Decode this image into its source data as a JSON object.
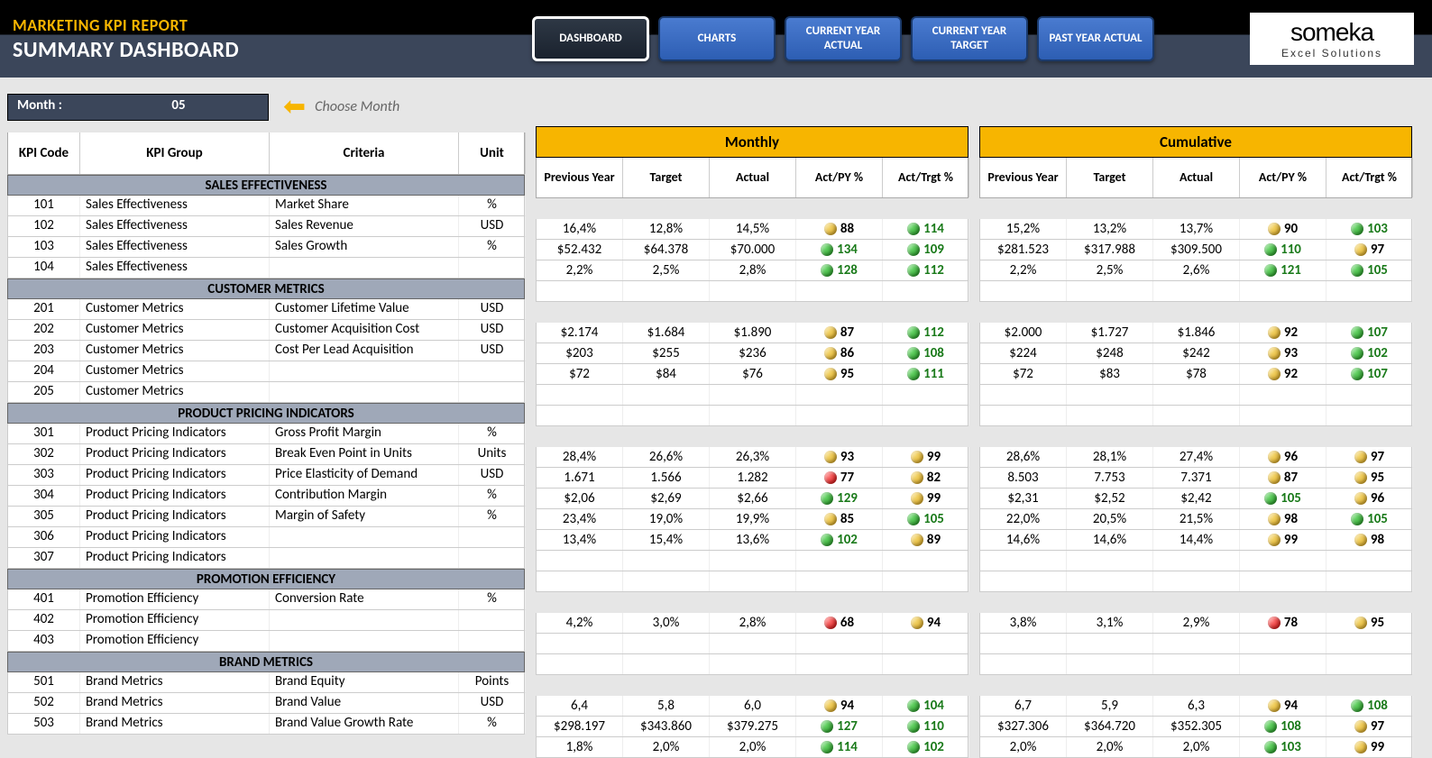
{
  "header": {
    "title": "MARKETING KPI REPORT",
    "subtitle": "SUMMARY DASHBOARD",
    "logo_name": "someka",
    "logo_sub": "Excel Solutions"
  },
  "nav": {
    "dashboard": "DASHBOARD",
    "charts": "CHARTS",
    "cy_actual": "CURRENT YEAR ACTUAL",
    "cy_target": "CURRENT YEAR TARGET",
    "py_actual": "PAST YEAR ACTUAL"
  },
  "month": {
    "label": "Month :",
    "value": "05",
    "choose": "Choose Month"
  },
  "left_headers": {
    "code": "KPI Code",
    "group": "KPI Group",
    "criteria": "Criteria",
    "unit": "Unit"
  },
  "data_section_monthly": "Monthly",
  "data_section_cumulative": "Cumulative",
  "data_headers": {
    "py": "Previous Year",
    "target": "Target",
    "actual": "Actual",
    "act_py": "Act/PY %",
    "act_trgt": "Act/Trgt %"
  },
  "groups": [
    {
      "title": "SALES EFFECTIVENESS",
      "rows": [
        {
          "code": "101",
          "group": "Sales Effectiveness",
          "criteria": "Market Share",
          "unit": "%",
          "m": {
            "py": "16,4%",
            "t": "12,8%",
            "a": "14,5%",
            "ap": "88",
            "apc": "y",
            "at": "114",
            "atc": "g"
          },
          "c": {
            "py": "15,2%",
            "t": "13,2%",
            "a": "13,7%",
            "ap": "90",
            "apc": "y",
            "at": "103",
            "atc": "g"
          }
        },
        {
          "code": "102",
          "group": "Sales Effectiveness",
          "criteria": "Sales Revenue",
          "unit": "USD",
          "m": {
            "py": "$52.432",
            "t": "$64.378",
            "a": "$70.000",
            "ap": "134",
            "apc": "g",
            "at": "109",
            "atc": "g"
          },
          "c": {
            "py": "$281.523",
            "t": "$317.988",
            "a": "$309.500",
            "ap": "110",
            "apc": "g",
            "at": "97",
            "atc": "y"
          }
        },
        {
          "code": "103",
          "group": "Sales Effectiveness",
          "criteria": "Sales Growth",
          "unit": "%",
          "m": {
            "py": "2,2%",
            "t": "2,5%",
            "a": "2,8%",
            "ap": "128",
            "apc": "g",
            "at": "112",
            "atc": "g"
          },
          "c": {
            "py": "2,2%",
            "t": "2,5%",
            "a": "2,6%",
            "ap": "121",
            "apc": "g",
            "at": "105",
            "atc": "g"
          }
        },
        {
          "code": "104",
          "group": "Sales Effectiveness",
          "criteria": "",
          "unit": "",
          "m": null,
          "c": null
        }
      ]
    },
    {
      "title": "CUSTOMER METRICS",
      "rows": [
        {
          "code": "201",
          "group": "Customer Metrics",
          "criteria": "Customer Lifetime Value",
          "unit": "USD",
          "m": {
            "py": "$2.174",
            "t": "$1.684",
            "a": "$1.890",
            "ap": "87",
            "apc": "y",
            "at": "112",
            "atc": "g"
          },
          "c": {
            "py": "$2.000",
            "t": "$1.727",
            "a": "$1.846",
            "ap": "92",
            "apc": "y",
            "at": "107",
            "atc": "g"
          }
        },
        {
          "code": "202",
          "group": "Customer Metrics",
          "criteria": "Customer Acquisition Cost",
          "unit": "USD",
          "m": {
            "py": "$203",
            "t": "$255",
            "a": "$236",
            "ap": "86",
            "apc": "y",
            "at": "108",
            "atc": "g"
          },
          "c": {
            "py": "$224",
            "t": "$248",
            "a": "$242",
            "ap": "93",
            "apc": "y",
            "at": "102",
            "atc": "g"
          }
        },
        {
          "code": "203",
          "group": "Customer Metrics",
          "criteria": "Cost Per Lead Acquisition",
          "unit": "USD",
          "m": {
            "py": "$72",
            "t": "$84",
            "a": "$76",
            "ap": "95",
            "apc": "y",
            "at": "111",
            "atc": "g"
          },
          "c": {
            "py": "$72",
            "t": "$83",
            "a": "$78",
            "ap": "92",
            "apc": "y",
            "at": "107",
            "atc": "g"
          }
        },
        {
          "code": "204",
          "group": "Customer Metrics",
          "criteria": "",
          "unit": "",
          "m": null,
          "c": null
        },
        {
          "code": "205",
          "group": "Customer Metrics",
          "criteria": "",
          "unit": "",
          "m": null,
          "c": null
        }
      ]
    },
    {
      "title": "PRODUCT PRICING INDICATORS",
      "rows": [
        {
          "code": "301",
          "group": "Product Pricing Indicators",
          "criteria": "Gross Profit Margin",
          "unit": "%",
          "m": {
            "py": "28,4%",
            "t": "26,6%",
            "a": "26,3%",
            "ap": "93",
            "apc": "y",
            "at": "99",
            "atc": "y"
          },
          "c": {
            "py": "28,6%",
            "t": "28,1%",
            "a": "27,4%",
            "ap": "96",
            "apc": "y",
            "at": "97",
            "atc": "y"
          }
        },
        {
          "code": "302",
          "group": "Product Pricing Indicators",
          "criteria": "Break Even Point in Units",
          "unit": "Units",
          "m": {
            "py": "1.671",
            "t": "1.566",
            "a": "1.282",
            "ap": "77",
            "apc": "r",
            "at": "82",
            "atc": "y"
          },
          "c": {
            "py": "8.503",
            "t": "7.753",
            "a": "7.371",
            "ap": "87",
            "apc": "y",
            "at": "95",
            "atc": "y"
          }
        },
        {
          "code": "303",
          "group": "Product Pricing Indicators",
          "criteria": "Price Elasticity of Demand",
          "unit": "USD",
          "m": {
            "py": "$2,06",
            "t": "$2,69",
            "a": "$2,66",
            "ap": "129",
            "apc": "g",
            "at": "99",
            "atc": "y"
          },
          "c": {
            "py": "$2,31",
            "t": "$2,52",
            "a": "$2,42",
            "ap": "105",
            "apc": "g",
            "at": "96",
            "atc": "y"
          }
        },
        {
          "code": "304",
          "group": "Product Pricing Indicators",
          "criteria": "Contribution Margin",
          "unit": "%",
          "m": {
            "py": "23,4%",
            "t": "19,0%",
            "a": "19,9%",
            "ap": "85",
            "apc": "y",
            "at": "105",
            "atc": "g"
          },
          "c": {
            "py": "22,0%",
            "t": "20,5%",
            "a": "21,5%",
            "ap": "98",
            "apc": "y",
            "at": "105",
            "atc": "g"
          }
        },
        {
          "code": "305",
          "group": "Product Pricing Indicators",
          "criteria": "Margin of Safety",
          "unit": "%",
          "m": {
            "py": "13,4%",
            "t": "15,4%",
            "a": "13,6%",
            "ap": "102",
            "apc": "g",
            "at": "89",
            "atc": "y"
          },
          "c": {
            "py": "14,6%",
            "t": "14,6%",
            "a": "14,4%",
            "ap": "99",
            "apc": "y",
            "at": "98",
            "atc": "y"
          }
        },
        {
          "code": "306",
          "group": "Product Pricing Indicators",
          "criteria": "",
          "unit": "",
          "m": null,
          "c": null
        },
        {
          "code": "307",
          "group": "Product Pricing Indicators",
          "criteria": "",
          "unit": "",
          "m": null,
          "c": null
        }
      ]
    },
    {
      "title": "PROMOTION EFFICIENCY",
      "rows": [
        {
          "code": "401",
          "group": "Promotion Efficiency",
          "criteria": "Conversion Rate",
          "unit": "%",
          "m": {
            "py": "4,2%",
            "t": "3,0%",
            "a": "2,8%",
            "ap": "68",
            "apc": "r",
            "at": "94",
            "atc": "y"
          },
          "c": {
            "py": "3,8%",
            "t": "3,1%",
            "a": "2,9%",
            "ap": "78",
            "apc": "r",
            "at": "95",
            "atc": "y"
          }
        },
        {
          "code": "402",
          "group": "Promotion Efficiency",
          "criteria": "",
          "unit": "",
          "m": null,
          "c": null
        },
        {
          "code": "403",
          "group": "Promotion Efficiency",
          "criteria": "",
          "unit": "",
          "m": null,
          "c": null
        }
      ]
    },
    {
      "title": "BRAND METRICS",
      "rows": [
        {
          "code": "501",
          "group": "Brand Metrics",
          "criteria": "Brand Equity",
          "unit": "Points",
          "m": {
            "py": "6,4",
            "t": "5,8",
            "a": "6,0",
            "ap": "94",
            "apc": "y",
            "at": "104",
            "atc": "g"
          },
          "c": {
            "py": "6,7",
            "t": "5,9",
            "a": "6,3",
            "ap": "94",
            "apc": "y",
            "at": "108",
            "atc": "g"
          }
        },
        {
          "code": "502",
          "group": "Brand Metrics",
          "criteria": "Brand Value",
          "unit": "USD",
          "m": {
            "py": "$298.197",
            "t": "$343.860",
            "a": "$379.275",
            "ap": "127",
            "apc": "g",
            "at": "110",
            "atc": "g"
          },
          "c": {
            "py": "$327.306",
            "t": "$364.720",
            "a": "$352.305",
            "ap": "108",
            "apc": "g",
            "at": "97",
            "atc": "y"
          }
        },
        {
          "code": "503",
          "group": "Brand Metrics",
          "criteria": "Brand Value Growth Rate",
          "unit": "%",
          "m": {
            "py": "1,8%",
            "t": "2,0%",
            "a": "2,0%",
            "ap": "114",
            "apc": "g",
            "at": "102",
            "atc": "g"
          },
          "c": {
            "py": "2,0%",
            "t": "2,0%",
            "a": "2,0%",
            "ap": "103",
            "apc": "g",
            "at": "99",
            "atc": "y"
          }
        }
      ]
    }
  ]
}
